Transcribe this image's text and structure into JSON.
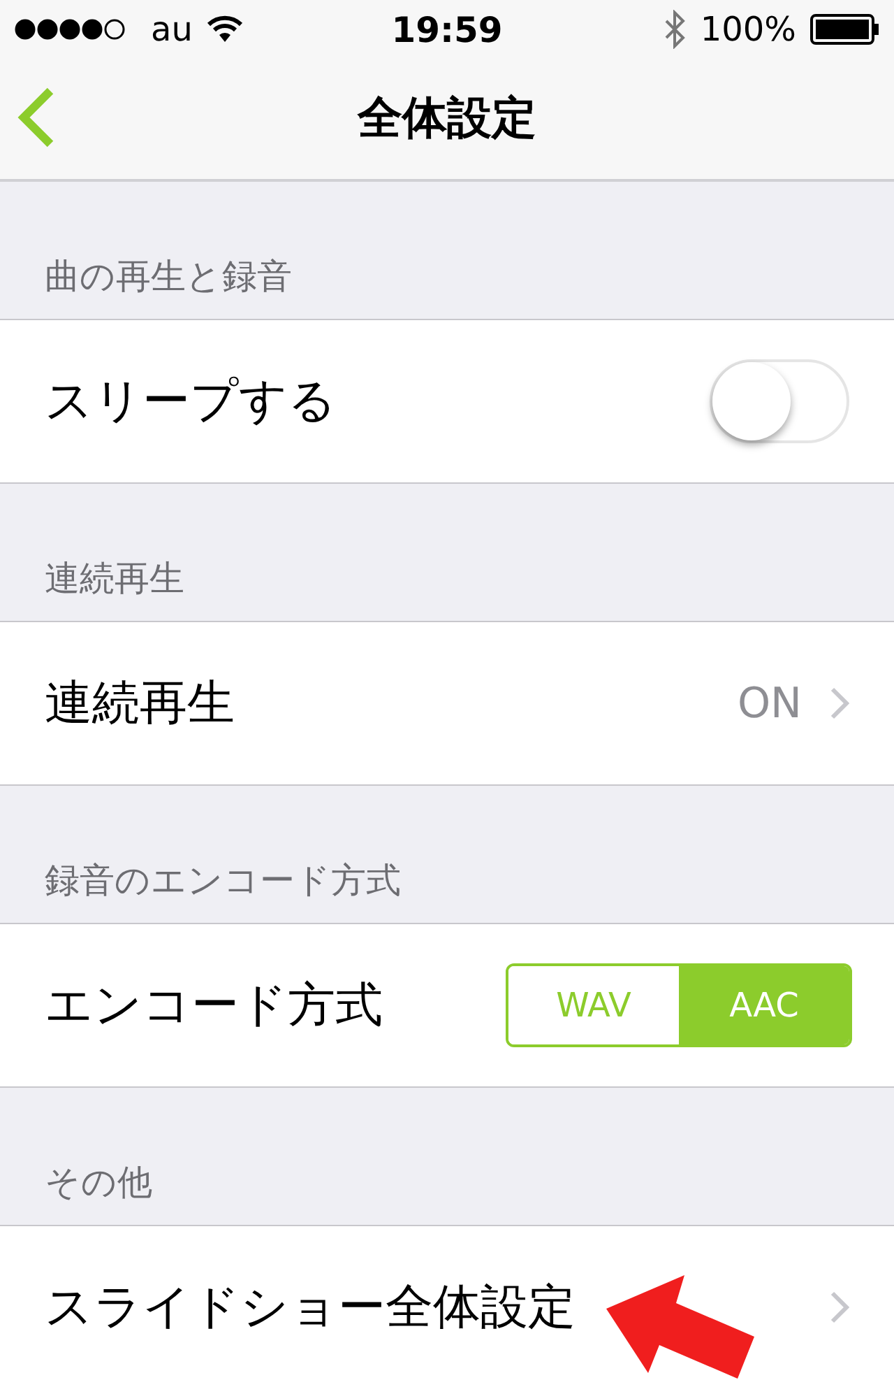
{
  "status_bar": {
    "carrier": "au",
    "time": "19:59",
    "battery": "100%"
  },
  "nav": {
    "title": "全体設定"
  },
  "sections": [
    {
      "header": "曲の再生と録音",
      "rows": [
        {
          "kind": "toggle",
          "label": "スリープする",
          "on": false
        }
      ]
    },
    {
      "header": "連続再生",
      "rows": [
        {
          "kind": "value",
          "label": "連続再生",
          "value": "ON"
        }
      ]
    },
    {
      "header": "録音のエンコード方式",
      "rows": [
        {
          "kind": "segmented",
          "label": "エンコード方式",
          "options": [
            {
              "label": "WAV",
              "selected": false
            },
            {
              "label": "AAC",
              "selected": true
            }
          ]
        }
      ]
    },
    {
      "header": "その他",
      "rows": [
        {
          "kind": "link",
          "label": "スライドショー全体設定"
        }
      ]
    }
  ]
}
